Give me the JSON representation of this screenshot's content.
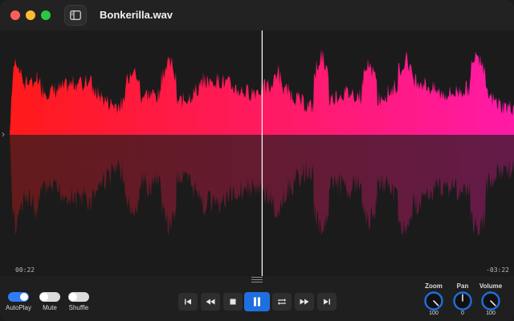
{
  "window": {
    "title": "Bonkerilla.wav"
  },
  "titlebar": {
    "sidebar_toggle_icon": "sidebar-toggle-icon"
  },
  "waveform": {
    "elapsed": "00:22",
    "remaining": "-03:22",
    "playhead_fraction": 0.51,
    "gradient_start": "#ff1a1a",
    "gradient_end": "#ff1aa8"
  },
  "toggles": [
    {
      "label": "AutoPlay",
      "on": true
    },
    {
      "label": "Mute",
      "on": false
    },
    {
      "label": "Shuffle",
      "on": false
    }
  ],
  "transport": [
    {
      "name": "skip-back-button",
      "icon": "skip-back-icon",
      "glyph": "⏮"
    },
    {
      "name": "rewind-button",
      "icon": "rewind-icon",
      "glyph": "⏪"
    },
    {
      "name": "stop-button",
      "icon": "stop-icon",
      "glyph": "■"
    },
    {
      "name": "pause-button",
      "icon": "pause-icon",
      "glyph": "⏸"
    },
    {
      "name": "repeat-button",
      "icon": "repeat-icon",
      "glyph": "🔁"
    },
    {
      "name": "fast-forward-button",
      "icon": "fast-forward-icon",
      "glyph": "⏩"
    },
    {
      "name": "skip-forward-button",
      "icon": "skip-forward-icon",
      "glyph": "⏭"
    }
  ],
  "knobs": [
    {
      "label": "Zoom",
      "value": "100",
      "level": 1.0
    },
    {
      "label": "Pan",
      "value": "0",
      "level": 0.5
    },
    {
      "label": "Volume",
      "value": "100",
      "level": 1.0
    }
  ],
  "colors": {
    "accent": "#1f6fe0"
  }
}
